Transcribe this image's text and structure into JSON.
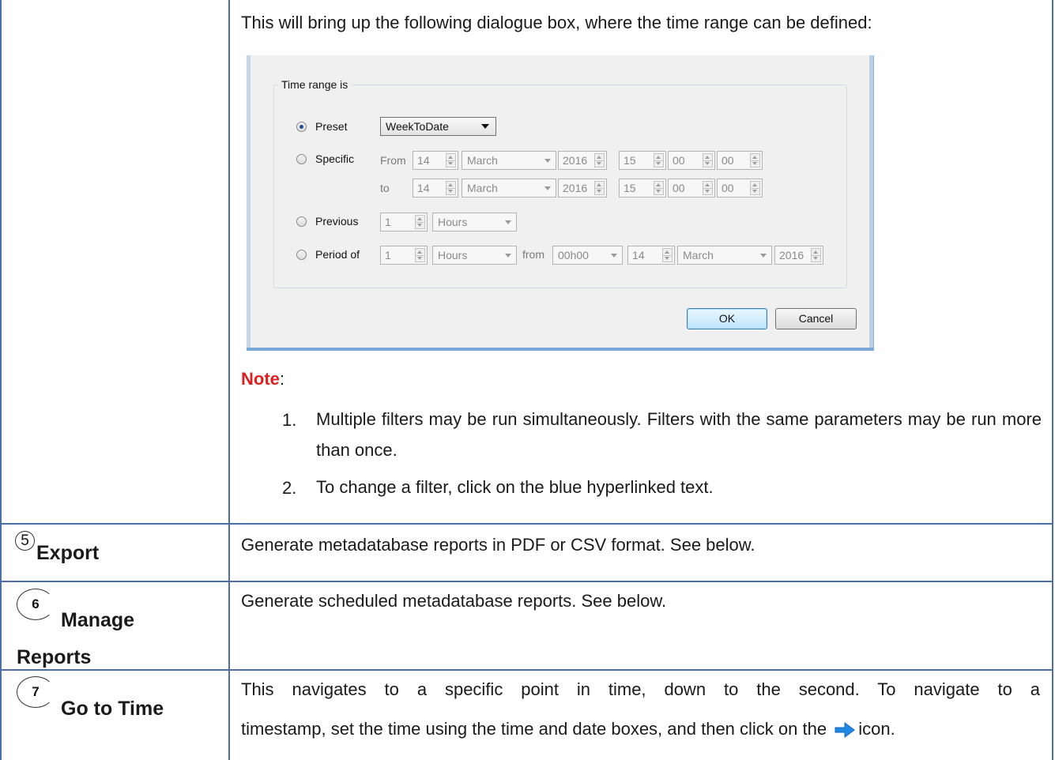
{
  "intro_text": "This will bring up the following dialogue box, where the time range can be defined:",
  "dialog": {
    "group_title": "Time range is",
    "preset": {
      "label": "Preset",
      "value": "WeekToDate",
      "checked": true
    },
    "specific": {
      "label": "Specific",
      "from_label": "From",
      "to_label": "to",
      "from": {
        "day": "14",
        "month": "March",
        "year": "2016",
        "hour": "15",
        "minute": "00",
        "second": "00"
      },
      "to": {
        "day": "14",
        "month": "March",
        "year": "2016",
        "hour": "15",
        "minute": "00",
        "second": "00"
      }
    },
    "previous": {
      "label": "Previous",
      "count": "1",
      "unit": "Hours"
    },
    "period_of": {
      "label": "Period of",
      "count": "1",
      "unit": "Hours",
      "from_label": "from",
      "time": "00h00",
      "day": "14",
      "month": "March",
      "year": "2016"
    },
    "ok_label": "OK",
    "cancel_label": "Cancel"
  },
  "note": {
    "label": "Note",
    "suffix": ":",
    "items": [
      {
        "num": "1.",
        "text": "Multiple filters may be run simultaneously. Filters with the same parameters may be run more than once."
      },
      {
        "num": "2.",
        "text": "To change a filter, click on the blue hyperlinked text."
      }
    ]
  },
  "rows": [
    {
      "num": "5",
      "title": "Export",
      "description": "Generate metadatabase reports in PDF or CSV format. See below."
    },
    {
      "num": "6",
      "title_line1": "Manage",
      "title_line2": "Reports",
      "description": "Generate scheduled metadatabase reports. See below."
    },
    {
      "num": "7",
      "title": "Go to Time",
      "description_line1": "This navigates to a specific point in time, down to the second. To navigate to a",
      "description_line2_before": "timestamp, set the time using the time and date boxes, and then click on the",
      "description_line2_after": "icon.",
      "icon": "right-arrow-icon",
      "icon_color": "#1e88e5"
    }
  ],
  "colors": {
    "table_border": "#4a6fa5",
    "note": "#e02020",
    "arrow": "#1e88e5"
  }
}
